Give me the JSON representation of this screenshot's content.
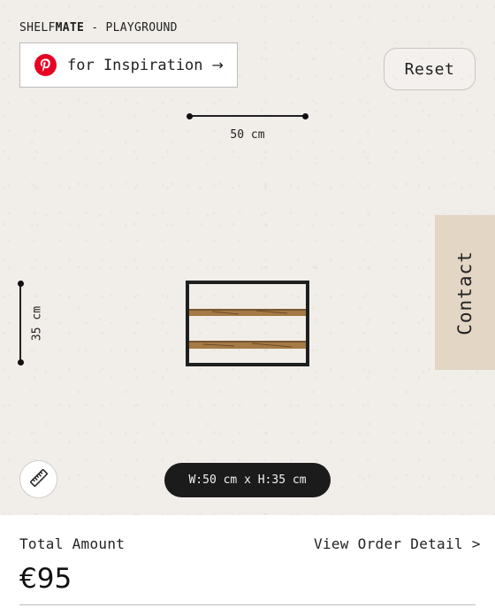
{
  "brand": {
    "part1": "SHELF",
    "part2": "MATE",
    "part3": " - PLAYGROUND"
  },
  "pinterest_button": {
    "label": "for Inspiration",
    "arrow": "→",
    "icon": "pinterest-icon",
    "color": "#e60023"
  },
  "reset_button": {
    "label": "Reset"
  },
  "width_dimension": {
    "label": "50 cm"
  },
  "height_dimension": {
    "label": "35 cm"
  },
  "contact_tab": {
    "label": "Contact",
    "color": "#e3d6c4"
  },
  "size_readout": {
    "label": "W:50 cm x H:35 cm"
  },
  "ruler_button": {
    "icon": "ruler-icon"
  },
  "order": {
    "total_label": "Total Amount",
    "view_detail_label": "View Order Detail >",
    "price": "€95"
  },
  "colors": {
    "canvas": "#f1eeea",
    "frame": "#1f1f1f",
    "wood": "#a57a45"
  }
}
